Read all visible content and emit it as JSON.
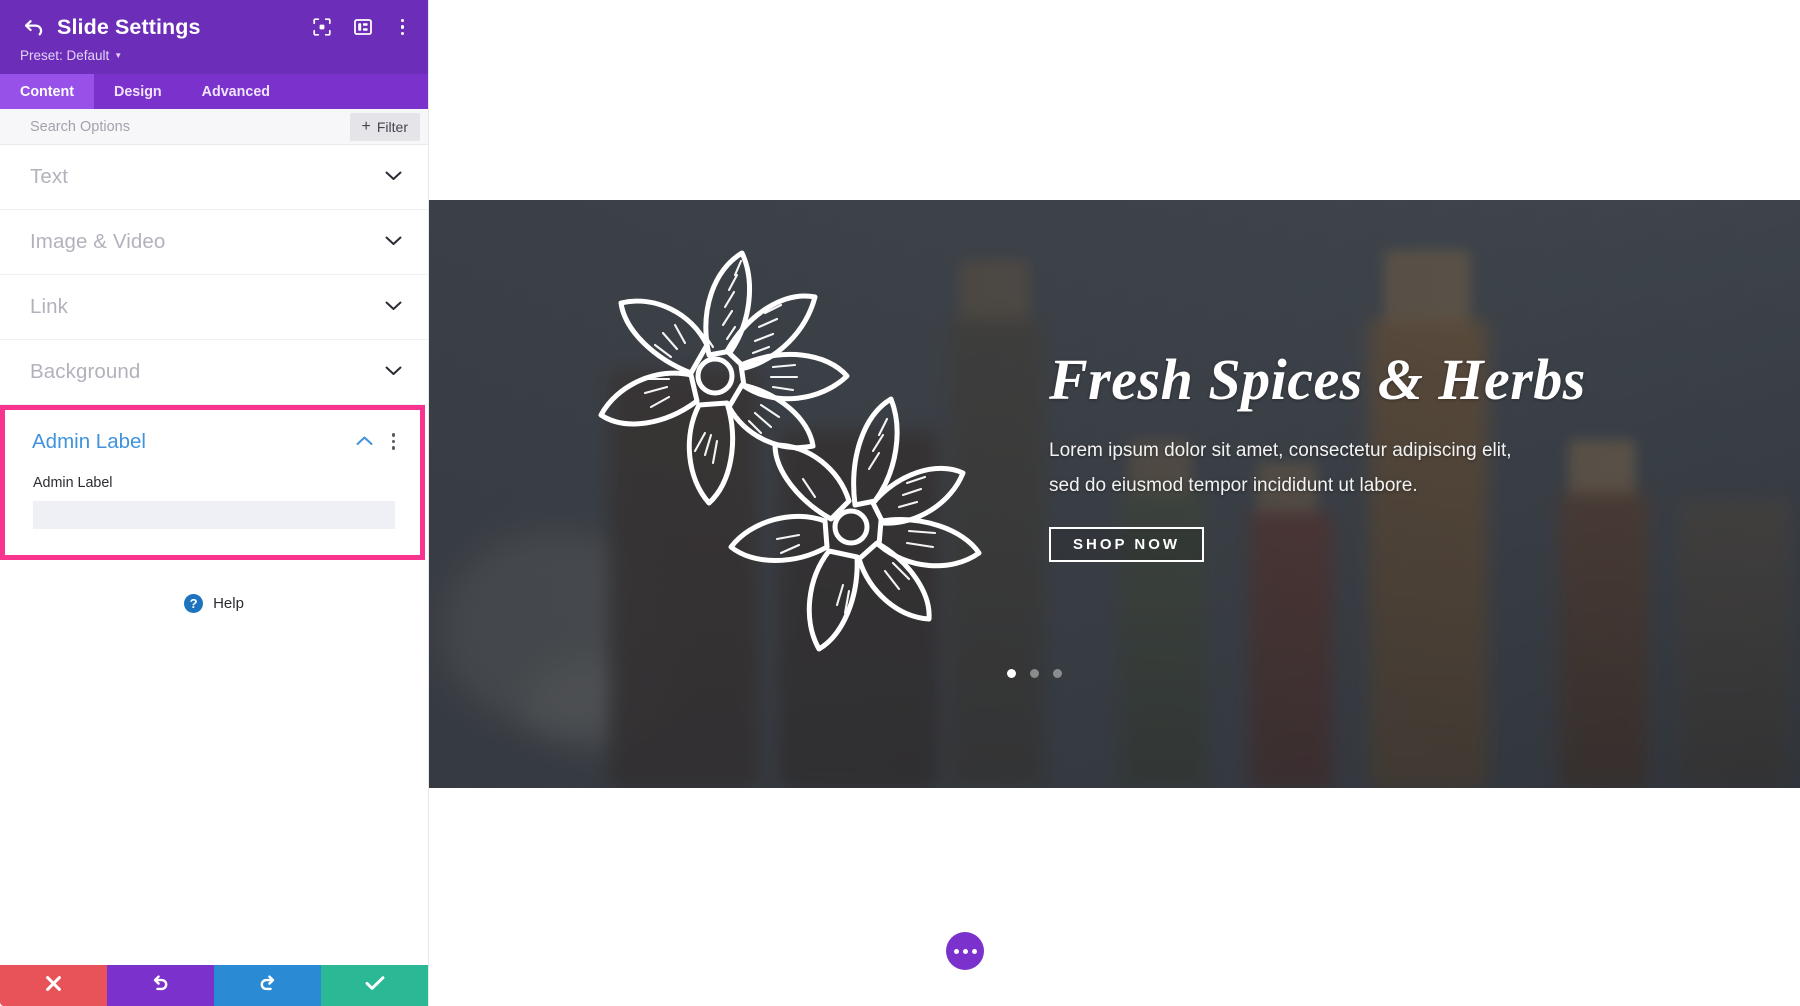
{
  "panel": {
    "title": "Slide Settings",
    "back_icon": "back-arrow-icon",
    "preset_label": "Preset: Default",
    "header_icons": [
      "focus-target-icon",
      "panel-layout-icon",
      "more-vertical-icon"
    ],
    "tabs": [
      {
        "label": "Content",
        "active": true
      },
      {
        "label": "Design",
        "active": false
      },
      {
        "label": "Advanced",
        "active": false
      }
    ],
    "search": {
      "placeholder": "Search Options",
      "value": ""
    },
    "filter_button": {
      "label": "Filter",
      "plus": "+"
    },
    "sections": [
      {
        "label": "Text",
        "state": "collapsed"
      },
      {
        "label": "Image & Video",
        "state": "collapsed"
      },
      {
        "label": "Link",
        "state": "collapsed"
      },
      {
        "label": "Background",
        "state": "collapsed"
      }
    ],
    "admin_label_section": {
      "title": "Admin Label",
      "state": "expanded",
      "highlighted": true,
      "highlight_color": "#f9348e",
      "title_color": "#3f93dd",
      "field": {
        "label": "Admin Label",
        "value": "",
        "placeholder": ""
      }
    },
    "help": {
      "label": "Help",
      "icon": "question-mark-icon"
    },
    "footer_buttons": [
      {
        "name": "cancel",
        "icon": "close-x-icon",
        "color": "#e8535a"
      },
      {
        "name": "undo",
        "icon": "undo-arrow-icon",
        "color": "#7b31cc"
      },
      {
        "name": "redo",
        "icon": "redo-arrow-icon",
        "color": "#2a8bd4"
      },
      {
        "name": "save",
        "icon": "checkmark-icon",
        "color": "#2bb894"
      }
    ]
  },
  "canvas": {
    "hero": {
      "title": "Fresh Spices & Herbs",
      "subtitle_line1": "Lorem ipsum dolor sit amet, consectetur adipiscing elit,",
      "subtitle_line2": "sed do eiusmod tempor incididunt ut labore.",
      "cta_label": "SHOP NOW",
      "slide_dots": 3,
      "active_dot": 1,
      "artwork": "star-anise-illustration",
      "background": "spice-jars-photo"
    },
    "fab": {
      "icon": "more-horizontal-icon",
      "color": "#7b31cc"
    }
  }
}
